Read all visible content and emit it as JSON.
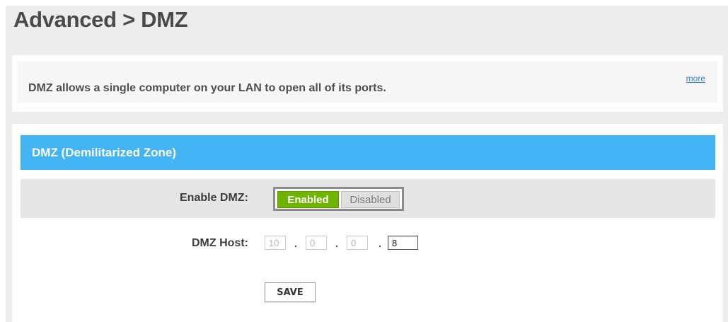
{
  "header": {
    "title": "Advanced > DMZ"
  },
  "info": {
    "description": "DMZ allows a single computer on your LAN to open all of its ports.",
    "more_link": "more"
  },
  "panel": {
    "title": "DMZ (Demilitarized Zone)",
    "enable_dmz": {
      "label": "Enable DMZ:",
      "options": [
        "Enabled",
        "Disabled"
      ],
      "selected": "Enabled"
    },
    "dmz_host": {
      "label": "DMZ Host:",
      "octets": [
        "10",
        "0",
        "0",
        "8"
      ],
      "separator": "."
    },
    "save_label": "SAVE"
  },
  "colors": {
    "accent_header": "#43b4f4",
    "toggle_enabled": "#6fb500",
    "page_background": "#ededed"
  }
}
